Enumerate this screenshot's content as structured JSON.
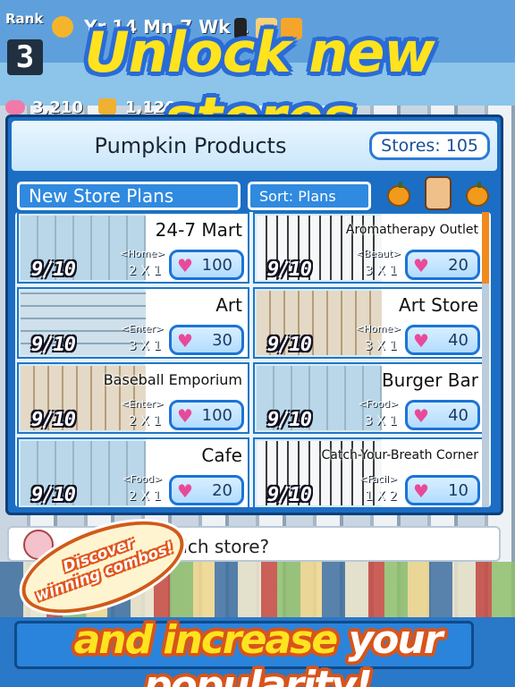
{
  "hud": {
    "rank_label": "Rank",
    "rank_value": "3",
    "date": "Yr 14 Mn 7 Wk 1",
    "hearts": "3,210",
    "money": "1,120"
  },
  "banners": {
    "top": "Unlock new stores",
    "bottom_part1": "and increase ",
    "bottom_part2": "your popularity!",
    "burst_line1": "Discover",
    "burst_line2": "winning combos!"
  },
  "panel": {
    "title": "Pumpkin Products",
    "stores_count": "Stores: 105",
    "tab_label": "New Store Plans",
    "sort_label": "Sort: Plans"
  },
  "stores": [
    {
      "name": "24-7 Mart",
      "level": "9/10",
      "category": "<Home>",
      "size": "2 X 1",
      "cost": "100"
    },
    {
      "name": "Aromatherapy Outlet",
      "level": "9/10",
      "category": "<Beaut>",
      "size": "3 X 1",
      "cost": "20"
    },
    {
      "name": "Art",
      "level": "9/10",
      "category": "<Enter>",
      "size": "3 X 1",
      "cost": "30"
    },
    {
      "name": "Art Store",
      "level": "9/10",
      "category": "<Home>",
      "size": "3 X 1",
      "cost": "40"
    },
    {
      "name": "Baseball Emporium",
      "level": "9/10",
      "category": "<Enter>",
      "size": "2 X 1",
      "cost": "100"
    },
    {
      "name": "Burger Bar",
      "level": "9/10",
      "category": "<Food>",
      "size": "3 X 1",
      "cost": "40"
    },
    {
      "name": "Cafe",
      "level": "9/10",
      "category": "<Food>",
      "size": "2 X 1",
      "cost": "20"
    },
    {
      "name": "Catch-Your-Breath Corner",
      "level": "9/10",
      "category": "<Facil>",
      "size": "1 X 2",
      "cost": "10"
    }
  ],
  "prompt": "Be... for which store?",
  "colors": {
    "accent": "#1b6ec4",
    "banner_yellow": "#ffe31f",
    "heart": "#e84a9a",
    "scroll": "#f08a1c"
  },
  "icons": [
    "heart-icon",
    "pumpkin-icon",
    "coin-icon",
    "sun-icon"
  ]
}
